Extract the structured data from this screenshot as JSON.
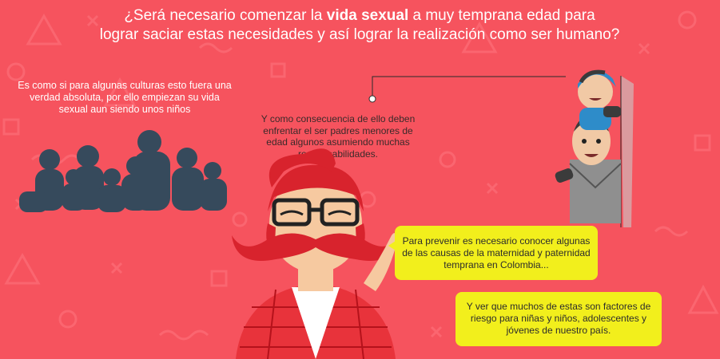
{
  "title": {
    "line1_pre": "¿Será necesario comenzar la ",
    "line1_bold": "vida sexual",
    "line1_post": " a muy temprana edad para",
    "line2": "lograr saciar estas necesidades y así lograr la realización como ser humano?"
  },
  "left_text": "Es como si para algunas culturas esto fuera una verdad absoluta, por ello empiezan su vida sexual aun siendo unos niños",
  "mid_text": "Y como consecuencia de ello deben enfrentar el ser padres menores de edad algunos asumiendo muchas responsabilidades.",
  "bubble1": "Para prevenir es necesario conocer algunas de las causas de la maternidad y paternidad temprana en Colombia...",
  "bubble2": "Y ver que muchos de estas son factores de riesgo para niñas y niños, adolescentes y jóvenes de nuestro país.",
  "colors": {
    "background": "#f6535e",
    "bubble": "#f2ef1c",
    "silhouette": "#364a5c"
  }
}
